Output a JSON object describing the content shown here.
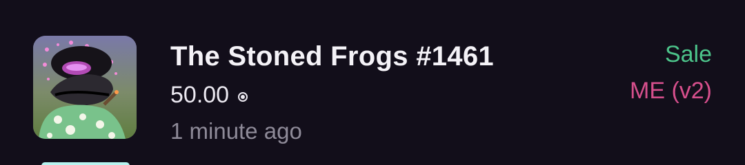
{
  "activity_item": {
    "title": "The Stoned Frogs #1461",
    "price": "50.00",
    "currency_icon": "sol-icon",
    "time": "1 minute ago",
    "tx_type": "Sale",
    "marketplace": "ME (v2)",
    "colors": {
      "background": "#120e1a",
      "sale": "#4cc38a",
      "marketplace": "#d64f8c",
      "muted": "#8e8a98"
    }
  }
}
